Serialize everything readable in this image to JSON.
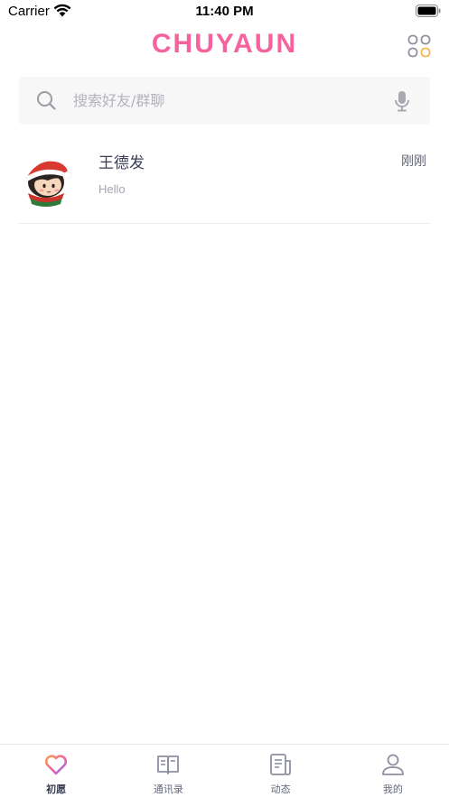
{
  "status_bar": {
    "carrier": "Carrier",
    "time": "11:40 PM"
  },
  "header": {
    "title": "CHUYAUN",
    "title_color": "#f5629e",
    "menu_icon": "grid-menu-icon"
  },
  "search": {
    "placeholder": "搜索好友/群聊",
    "value": "",
    "icon": "search-icon",
    "voice_icon": "mic-icon"
  },
  "conversations": [
    {
      "name": "王德发",
      "time": "刚刚",
      "last_message": "Hello",
      "avatar": "christmas-boy-avatar"
    }
  ],
  "tabs": [
    {
      "label": "初愿",
      "icon": "heart-icon",
      "active": true
    },
    {
      "label": "通讯录",
      "icon": "contacts-book-icon",
      "active": false
    },
    {
      "label": "动态",
      "icon": "feed-icon",
      "active": false
    },
    {
      "label": "我的",
      "icon": "profile-icon",
      "active": false
    }
  ],
  "colors": {
    "accent": "#f5629e",
    "heart_gradient": [
      "#f9a04b",
      "#f5629e",
      "#8a6cf0"
    ],
    "text_primary": "#3a3d55",
    "text_secondary": "#a4a6b1"
  }
}
